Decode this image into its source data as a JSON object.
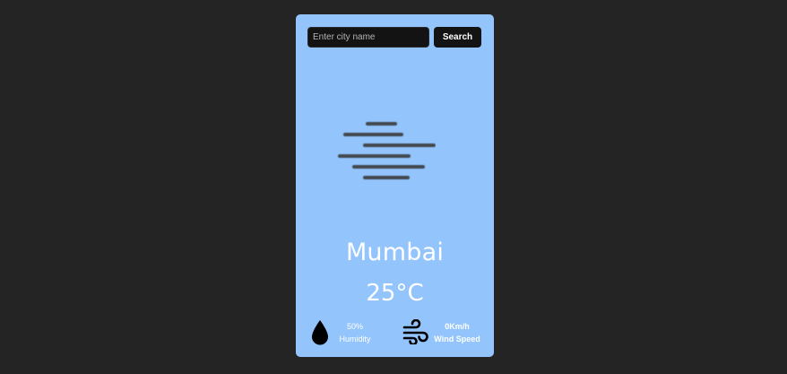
{
  "search": {
    "placeholder": "Enter city name",
    "value": "",
    "button_label": "Search"
  },
  "weather": {
    "icon": "mist-icon",
    "city": "Mumbai",
    "temperature": "25°C"
  },
  "details": {
    "humidity": {
      "icon": "water-drop-icon",
      "value": "50%",
      "label": "Humidity"
    },
    "wind": {
      "icon": "wind-icon",
      "value": "0Km/h",
      "label": "Wind Speed"
    }
  },
  "colors": {
    "background": "#242424",
    "card": "#93c5fc",
    "input": "#131313",
    "text": "#ffffff"
  }
}
